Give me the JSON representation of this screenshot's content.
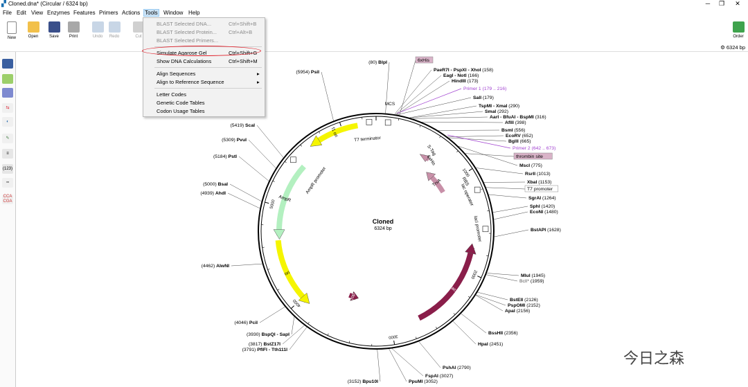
{
  "window": {
    "title": "Cloned.dna* (Circular / 6324 bp)"
  },
  "menu": [
    "File",
    "Edit",
    "View",
    "Enzymes",
    "Features",
    "Primers",
    "Actions",
    "Tools",
    "Window",
    "Help"
  ],
  "toolbar": {
    "buttons": [
      "New",
      "Open",
      "Save",
      "Print",
      "Undo",
      "Redo",
      "Cut"
    ],
    "order_label": "Order"
  },
  "status": {
    "length": "6324 bp"
  },
  "left_tools": {
    "count_label": "(123)",
    "cca_top": "CCA",
    "cca_bottom": "CGA"
  },
  "tools_menu": {
    "items": [
      {
        "label": "BLAST Selected DNA...",
        "shortcut": "Ctrl+Shift+B",
        "enabled": false
      },
      {
        "label": "BLAST Selected Protein...",
        "shortcut": "Ctrl+Alt+B",
        "enabled": false
      },
      {
        "label": "BLAST Selected Primers...",
        "shortcut": "",
        "enabled": false
      },
      {
        "label": "Simulate Agarose Gel",
        "shortcut": "Ctrl+Shift+G",
        "enabled": true
      },
      {
        "label": "Show DNA Calculations",
        "shortcut": "Ctrl+Shift+M",
        "enabled": true
      },
      {
        "label": "Align Sequences",
        "shortcut": "",
        "enabled": true,
        "submenu": true
      },
      {
        "label": "Align to Reference Sequence",
        "shortcut": "",
        "enabled": true,
        "submenu": true
      },
      {
        "label": "Letter Codes",
        "shortcut": "",
        "enabled": true
      },
      {
        "label": "Genetic Code Tables",
        "shortcut": "",
        "enabled": true
      },
      {
        "label": "Codon Usage Tables",
        "shortcut": "",
        "enabled": true
      }
    ]
  },
  "plasmid": {
    "name": "Cloned",
    "size_label": "6324 bp",
    "total_bp": 6324,
    "ticks": [
      "1000",
      "2000",
      "3000",
      "4000",
      "5000",
      "6000"
    ],
    "features": [
      {
        "name": "f1 ori",
        "color": "#f5f500"
      },
      {
        "name": "T7 terminator",
        "color": "#ffffff"
      },
      {
        "name": "MCS",
        "color": "#ffffff"
      },
      {
        "name": "AmpR promoter",
        "color": "#ffffff"
      },
      {
        "name": "AmpR",
        "color": "#b3f0c0"
      },
      {
        "name": "ori",
        "color": "#f5f500"
      },
      {
        "name": "rop",
        "color": "#8a1e4a"
      },
      {
        "name": "lacI",
        "color": "#8a1e4a"
      },
      {
        "name": "lacI promoter",
        "color": "#ffffff"
      },
      {
        "name": "lac operator",
        "color": "#ffffff"
      },
      {
        "name": "RBS",
        "color": "#ffffff"
      },
      {
        "name": "TrxA",
        "color": "#c890a8"
      },
      {
        "name": "S-Tag",
        "color": "#c890a8"
      },
      {
        "name": "6xHis",
        "color": "#c890a8"
      }
    ],
    "boxed_labels": [
      "6xHis",
      "thrombin site",
      "T7 promoter"
    ],
    "primers": [
      {
        "name": "Primer 1",
        "range": "(179 .. 216)"
      },
      {
        "name": "Primer 2",
        "range": "(642 .. 673)"
      }
    ],
    "sites": [
      {
        "name": "BlpI",
        "pos": "(80)"
      },
      {
        "name": "PaeR7I - PspXI - XhoI",
        "pos": "(158)"
      },
      {
        "name": "EagI - NotI",
        "pos": "(166)"
      },
      {
        "name": "HindIII",
        "pos": "(173)"
      },
      {
        "name": "SalI",
        "pos": "(179)"
      },
      {
        "name": "TspMI - XmaI",
        "pos": "(290)"
      },
      {
        "name": "SmaI",
        "pos": "(292)"
      },
      {
        "name": "AarI - BfuAI - BspMI",
        "pos": "(316)"
      },
      {
        "name": "AflII",
        "pos": "(398)"
      },
      {
        "name": "BsmI",
        "pos": "(556)"
      },
      {
        "name": "EcoRV",
        "pos": "(652)"
      },
      {
        "name": "BglII",
        "pos": "(665)"
      },
      {
        "name": "MscI",
        "pos": "(775)"
      },
      {
        "name": "RsrII",
        "pos": "(1013)"
      },
      {
        "name": "XbaI",
        "pos": "(1153)"
      },
      {
        "name": "SgrAI",
        "pos": "(1264)"
      },
      {
        "name": "SphI",
        "pos": "(1420)"
      },
      {
        "name": "EcoNI",
        "pos": "(1480)"
      },
      {
        "name": "BstAPI",
        "pos": "(1628)"
      },
      {
        "name": "MluI",
        "pos": "(1945)"
      },
      {
        "name": "BclI*",
        "pos": "(1959)"
      },
      {
        "name": "BstEII",
        "pos": "(2126)"
      },
      {
        "name": "PspOMI",
        "pos": "(2152)"
      },
      {
        "name": "ApaI",
        "pos": "(2156)"
      },
      {
        "name": "BssHII",
        "pos": "(2356)"
      },
      {
        "name": "HpaI",
        "pos": "(2451)"
      },
      {
        "name": "PshAI",
        "pos": "(2790)"
      },
      {
        "name": "FspAI",
        "pos": "(3027)"
      },
      {
        "name": "PpuMI",
        "pos": "(3052)"
      },
      {
        "name": "Bpu10I",
        "pos": "(3152)"
      },
      {
        "name": "PflFI - Tth111I",
        "pos": "(3791)"
      },
      {
        "name": "BstZ17I",
        "pos": "(3817)"
      },
      {
        "name": "BspQI - SapI",
        "pos": "(3930)"
      },
      {
        "name": "PciI",
        "pos": "(4046)"
      },
      {
        "name": "AlwNI",
        "pos": "(4462)"
      },
      {
        "name": "AhdI",
        "pos": "(4939)"
      },
      {
        "name": "BsaI",
        "pos": "(5000)"
      },
      {
        "name": "PstI",
        "pos": "(5184)"
      },
      {
        "name": "PvuI",
        "pos": "(5309)"
      },
      {
        "name": "ScaI",
        "pos": "(5419)"
      },
      {
        "name": "PsiI",
        "pos": "(5954)"
      }
    ]
  },
  "watermark": "今日之森"
}
